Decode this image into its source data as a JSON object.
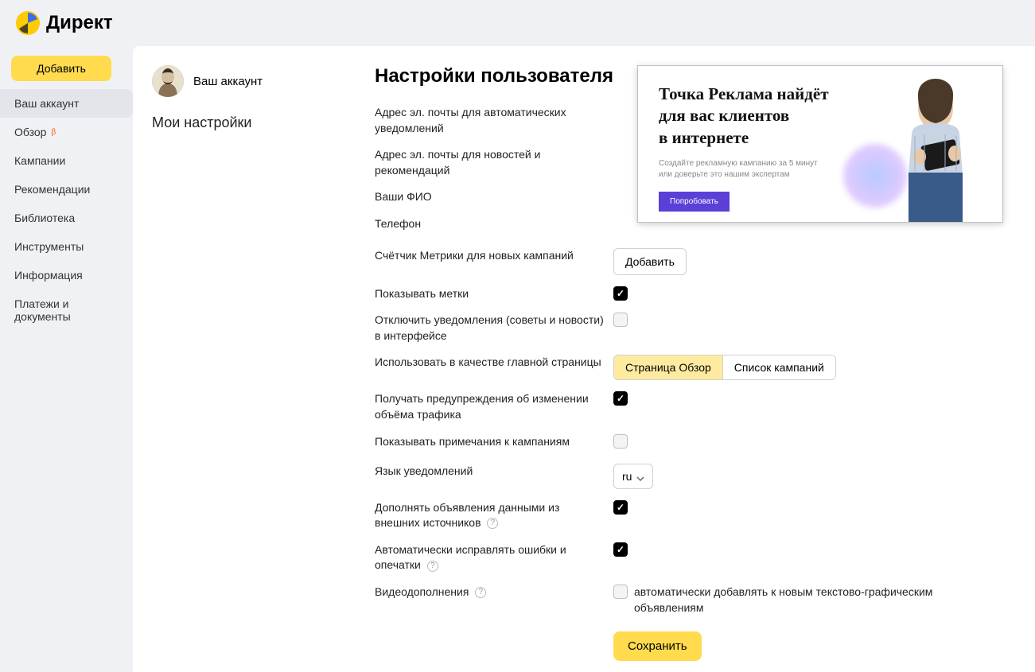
{
  "brand": "Директ",
  "sidebar": {
    "add": "Добавить",
    "items": [
      {
        "label": "Ваш аккаунт",
        "active": true
      },
      {
        "label": "Обзор",
        "beta": "β"
      },
      {
        "label": "Кампании"
      },
      {
        "label": "Рекомендации"
      },
      {
        "label": "Библиотека"
      },
      {
        "label": "Инструменты"
      },
      {
        "label": "Информация"
      },
      {
        "label": "Платежи и документы"
      }
    ]
  },
  "account": {
    "name": "Ваш аккаунт",
    "my_settings": "Мои настройки"
  },
  "page_title": "Настройки пользователя",
  "rows": {
    "email_notify": "Адрес эл. почты для автоматических уведомлений",
    "email_news": "Адрес эл. почты для новостей и рекомендаций",
    "fio": "Ваши ФИО",
    "phone": "Телефон",
    "metrika": "Счётчик Метрики для новых кампаний",
    "show_tags": "Показывать метки",
    "disable_tips": "Отключить уведомления (советы и новости) в интерфейсе",
    "homepage": "Использовать в качестве главной страницы",
    "traffic_warn": "Получать предупреждения об изменении объёма трафика",
    "show_notes": "Показывать примечания к кампаниям",
    "lang": "Язык уведомлений",
    "external_data": "Дополнять объявления данными из внешних источников",
    "auto_fix": "Автоматически исправлять ошибки и опечатки",
    "video_ext": "Видеодополнения"
  },
  "controls": {
    "add_button": "Добавить",
    "homepage_options": [
      "Страница Обзор",
      "Список кампаний"
    ],
    "lang_value": "ru",
    "video_checkbox_label": "автоматически добавлять к новым текстово-графическим объявлениям",
    "save": "Сохранить"
  },
  "promo": {
    "title_line1": "Точка Реклама найдёт",
    "title_line2": "для вас клиентов",
    "title_line3": "в интернете",
    "sub": "Создайте рекламную кампанию за 5 минут или доверьте это нашим экспертам",
    "cta": "Попробовать"
  }
}
